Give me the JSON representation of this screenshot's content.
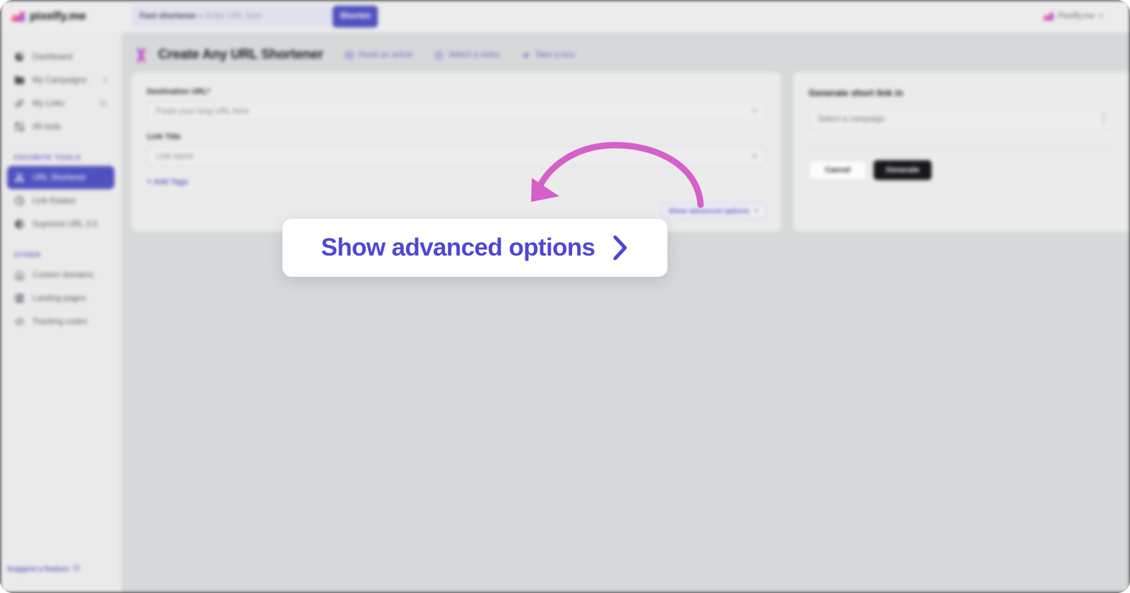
{
  "topbar": {
    "brand": "pixelfy.me",
    "brand_icon": "pixelfy-logo-icon",
    "fast_shortener_label": "Fast shortener –",
    "fast_shortener_placeholder": "Enter URL here",
    "shorten_button": "Shorten",
    "account_name": "Pixelfy.me",
    "account_icon": "pixelfy-logo-icon",
    "account_caret_icon": "chevron-down-icon"
  },
  "sidebar": {
    "main_items": [
      {
        "label": "Dashboard",
        "icon": "dashboard-pie-icon",
        "count": "",
        "active": false
      },
      {
        "label": "My Campaigns",
        "icon": "folder-icon",
        "count": "3",
        "active": false
      },
      {
        "label": "My Links",
        "icon": "link-chain-icon",
        "count": "31",
        "active": false
      },
      {
        "label": "All tools",
        "icon": "grid-tools-icon",
        "count": "",
        "active": false
      }
    ],
    "favorite_group_title": "FAVORITE TOOLS",
    "favorite_items": [
      {
        "label": "URL Shortener",
        "icon": "scissors-icon",
        "count": "",
        "active": true
      },
      {
        "label": "Link Rotator",
        "icon": "rotator-circle-icon",
        "count": "",
        "active": false
      },
      {
        "label": "Supreme URL 3.0",
        "icon": "supreme-badge-icon",
        "count": "",
        "active": false
      }
    ],
    "other_group_title": "OTHER",
    "other_items": [
      {
        "label": "Custom domains",
        "icon": "home-icon",
        "count": "",
        "active": false
      },
      {
        "label": "Landing pages",
        "icon": "page-icon",
        "count": "",
        "active": false
      },
      {
        "label": "Tracking codes",
        "icon": "code-brackets-icon",
        "count": "",
        "active": false
      }
    ],
    "suggest_feature": "Suggest a feature",
    "suggest_feature_icon": "external-link-icon"
  },
  "page": {
    "title": "Create Any URL Shortener",
    "title_icon": "pixelfy-x-icon",
    "links": [
      {
        "label": "Read an article",
        "icon": "book-icon"
      },
      {
        "label": "Watch a video",
        "icon": "play-circle-icon"
      },
      {
        "label": "Take a tour",
        "icon": "rocket-icon"
      }
    ]
  },
  "form": {
    "destination_label": "Destination URL*",
    "destination_placeholder": "Paste your long URL here",
    "destination_value": "",
    "destination_clear_icon": "clear-x-icon",
    "title_label": "Link Title",
    "title_placeholder": "Link name",
    "title_value": "",
    "title_clear_icon": "clear-x-icon",
    "add_tags": "+ Add Tags",
    "show_advanced_label": "Show advanced options",
    "show_advanced_icon": "chevron-down-icon"
  },
  "right_panel": {
    "title": "Generate short link in",
    "campaign_placeholder": "Select a campaign",
    "campaign_arrows_icon": "select-updown-icon",
    "cancel_label": "Cancel",
    "generate_label": "Generate"
  },
  "coach_mark": {
    "label": "Show advanced options",
    "chevron_icon": "chevron-right-icon",
    "arrow_icon": "curved-arrow-icon",
    "arrow_color": "#d560c8",
    "accent_color": "#4f46d6"
  },
  "colors": {
    "accent": "#4f51bf",
    "coach_text": "#4f46d6",
    "arrow": "#d560c8",
    "canvas_bg": "#d5d9da",
    "sidebar_bg": "#eaeaea",
    "card_bg": "#ebebec",
    "dark_button": "#17171c"
  }
}
